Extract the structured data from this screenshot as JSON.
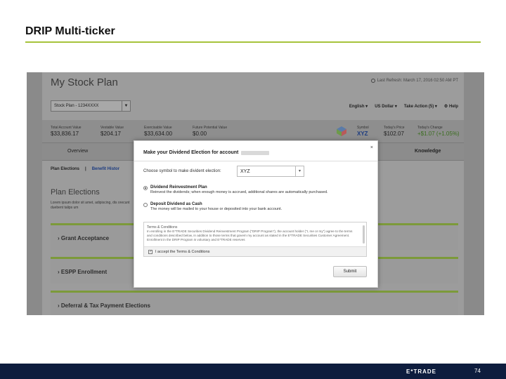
{
  "slide": {
    "title": "DRIP Multi-ticker",
    "page_number": "74",
    "brand": "E*TRADE"
  },
  "app": {
    "title": "My Stock Plan",
    "last_refresh": "Last Refresh: March 17, 2016 02:50 AM PT",
    "plan_select_value": "Stock Plan - 1234XXXX",
    "controls": {
      "language": "English",
      "currency": "US Dollar",
      "take_action": "Take Action (5)",
      "help": "Help"
    },
    "summary": [
      {
        "label": "Total Account Value",
        "value": "$33,836.17"
      },
      {
        "label": "Vestable Value",
        "value": "$204.17"
      },
      {
        "label": "Exercisable Value",
        "value": "$33,634.00"
      },
      {
        "label": "Future Potential Value",
        "value": "$0.00"
      },
      {
        "label": "Symbol",
        "value": "XYZ"
      },
      {
        "label": "Today's Price",
        "value": "$102.07"
      },
      {
        "label": "Today's Change",
        "value": "+$1.07 (+1.05%)"
      }
    ],
    "tabs": {
      "overview": "Overview",
      "knowledge": "Knowledge"
    },
    "subnav": {
      "plan_elections": "Plan Elections",
      "separator": "|",
      "benefit_history": "Benefit Histor"
    },
    "section": {
      "title": "Plan Elections",
      "description": "Lorem ipsum dolor sit amet, adipiscing, dis orecunt duebent talips um"
    },
    "panels": [
      "Grant Acceptance",
      "ESPP Enrollment",
      "Deferral & Tax Payment Elections"
    ]
  },
  "modal": {
    "title": "Make your Dividend Election for account",
    "close": "×",
    "choose_label": "Choose symbol to make divident election:",
    "symbol_value": "XYZ",
    "options": [
      {
        "title": "Dividend Reinvestment Plan",
        "desc": "Reinvest the dividends; when enough money is accrued, additional shares are automatically purchased.",
        "checked": true
      },
      {
        "title": "Deposit Dividend as Cash",
        "desc": "The money will be mailed to your house or deposited into your bank account.",
        "checked": false
      }
    ],
    "terms": {
      "heading": "Terms & Conditions",
      "text": "In enrolling in the E*TRADE Securities Dividend Reinvestment Program (\"DRIP Program\"), the account holder (\"I, me or my\") agree to the terms and conditions described below, in addition to those terms that govern my account as stated in the E*TRADE Securities Customer Agreement. Enrollment in the DRIP Program is voluntary and E*TRADE reserves",
      "accept_label": "I accept the Terms & Conditions",
      "accept_checked": "✓"
    },
    "submit": "Submit"
  },
  "colors": {
    "accent_green": "#a6c33a",
    "footer_navy": "#0e1d3e",
    "link_blue": "#1d3c80"
  }
}
